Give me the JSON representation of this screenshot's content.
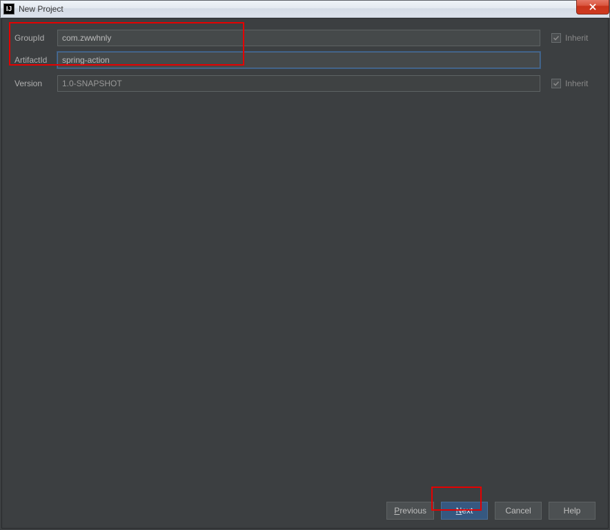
{
  "titlebar": {
    "icon_text": "IJ",
    "title": "New Project"
  },
  "form": {
    "groupId": {
      "label": "GroupId",
      "value": "com.zwwhnly"
    },
    "artifactId": {
      "label": "ArtifactId",
      "value": "spring-action"
    },
    "version": {
      "label": "Version",
      "value": "1.0-SNAPSHOT"
    },
    "inherit_label": "Inherit"
  },
  "buttons": {
    "previous": "Previous",
    "previous_mnemonic": "P",
    "next": "Next",
    "next_mnemonic": "N",
    "cancel": "Cancel",
    "help": "Help"
  }
}
